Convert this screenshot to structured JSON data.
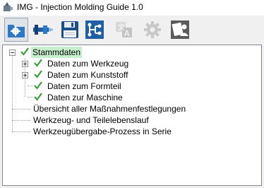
{
  "window": {
    "title": "IMG - Injection Molding Guide 1.0"
  },
  "toolbar": {
    "buttons": [
      {
        "icon": "folder-gear-icon",
        "active": true
      },
      {
        "icon": "injection-machine-icon",
        "active": false
      },
      {
        "icon": "save-disk-icon",
        "active": false
      },
      {
        "icon": "network-tree-icon",
        "active": false
      },
      {
        "icon": "translate-icon",
        "disabled": true
      },
      {
        "icon": "settings-gear-icon",
        "disabled": true
      },
      {
        "icon": "user-manual-icon",
        "active": false
      }
    ]
  },
  "tree": {
    "root": {
      "label": "Stammdaten",
      "checked": true,
      "expanded": true,
      "selected": true
    },
    "children": [
      {
        "label": "Daten zum Werkzeug",
        "checked": true,
        "expandable": true
      },
      {
        "label": "Daten zum Kunststoff",
        "checked": true,
        "expandable": true
      },
      {
        "label": "Daten zum Formteil",
        "checked": true,
        "expandable": false
      },
      {
        "label": "Daten zur Maschine",
        "checked": true,
        "expandable": false
      }
    ],
    "siblings": [
      {
        "label": "Übersicht aller Maßnahmenfestlegungen"
      },
      {
        "label": "Werkzeug- und Teilelebenslauf"
      },
      {
        "label": "Werkzeugübergabe-Prozess in Serie"
      }
    ]
  },
  "colors": {
    "check": "#2f9b2f",
    "selection": "#c6efce",
    "toolbar_active": "#dde3e8"
  }
}
